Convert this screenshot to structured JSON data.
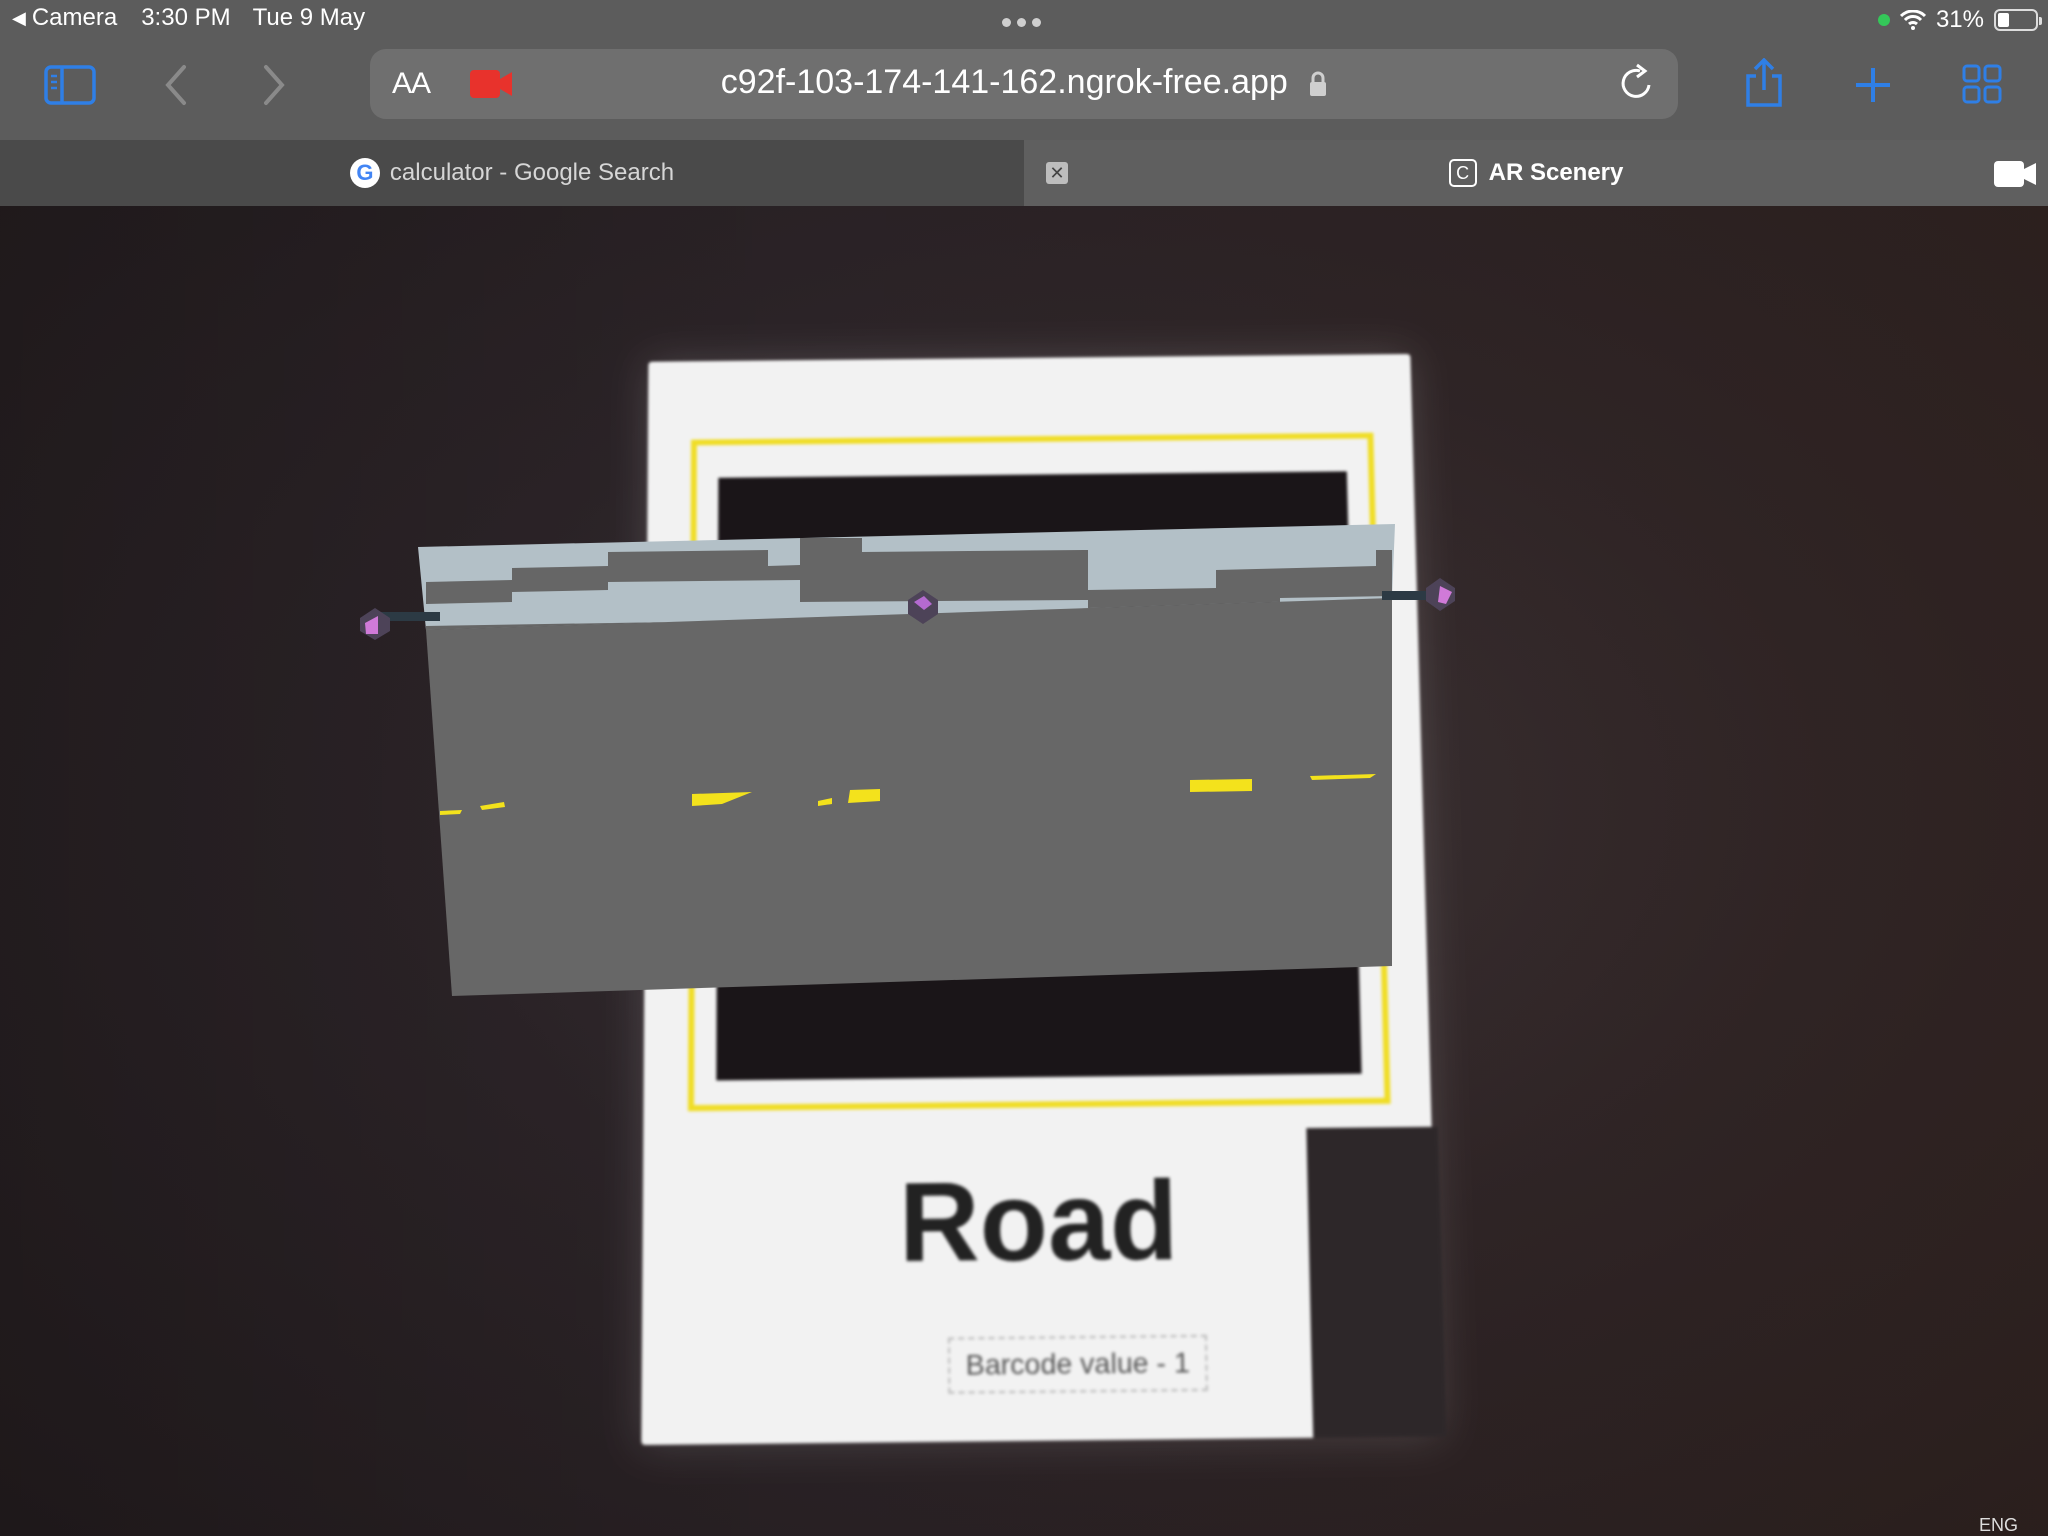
{
  "status_bar": {
    "back_app": "Camera",
    "time": "3:30 PM",
    "date": "Tue 9 May",
    "battery": "31%",
    "battery_level": 0.31
  },
  "toolbar": {
    "text_size_label": "AA",
    "url": "c92f-103-174-141-162.ngrok-free.app",
    "icons": [
      "sidebar-icon",
      "back-icon",
      "forward-icon",
      "camera-recording-icon",
      "lock-icon",
      "reload-icon",
      "share-icon",
      "new-tab-icon",
      "tab-overview-icon"
    ]
  },
  "tabs": [
    {
      "title": "calculator - Google Search",
      "favicon": "google-icon",
      "active": false
    },
    {
      "title": "AR Scenery",
      "favicon": "C",
      "active": true
    }
  ],
  "scene": {
    "marker_title": "Road",
    "marker_caption": "Barcode value - 1",
    "taskbar_text": "ENG"
  },
  "colors": {
    "chrome": "#5c5c5c",
    "accent_blue": "#2f7fe6",
    "record_red": "#e8322c",
    "marker_yellow": "#f0dd25",
    "road_gray": "#676767",
    "sky_blue": "#b3c0c7"
  }
}
